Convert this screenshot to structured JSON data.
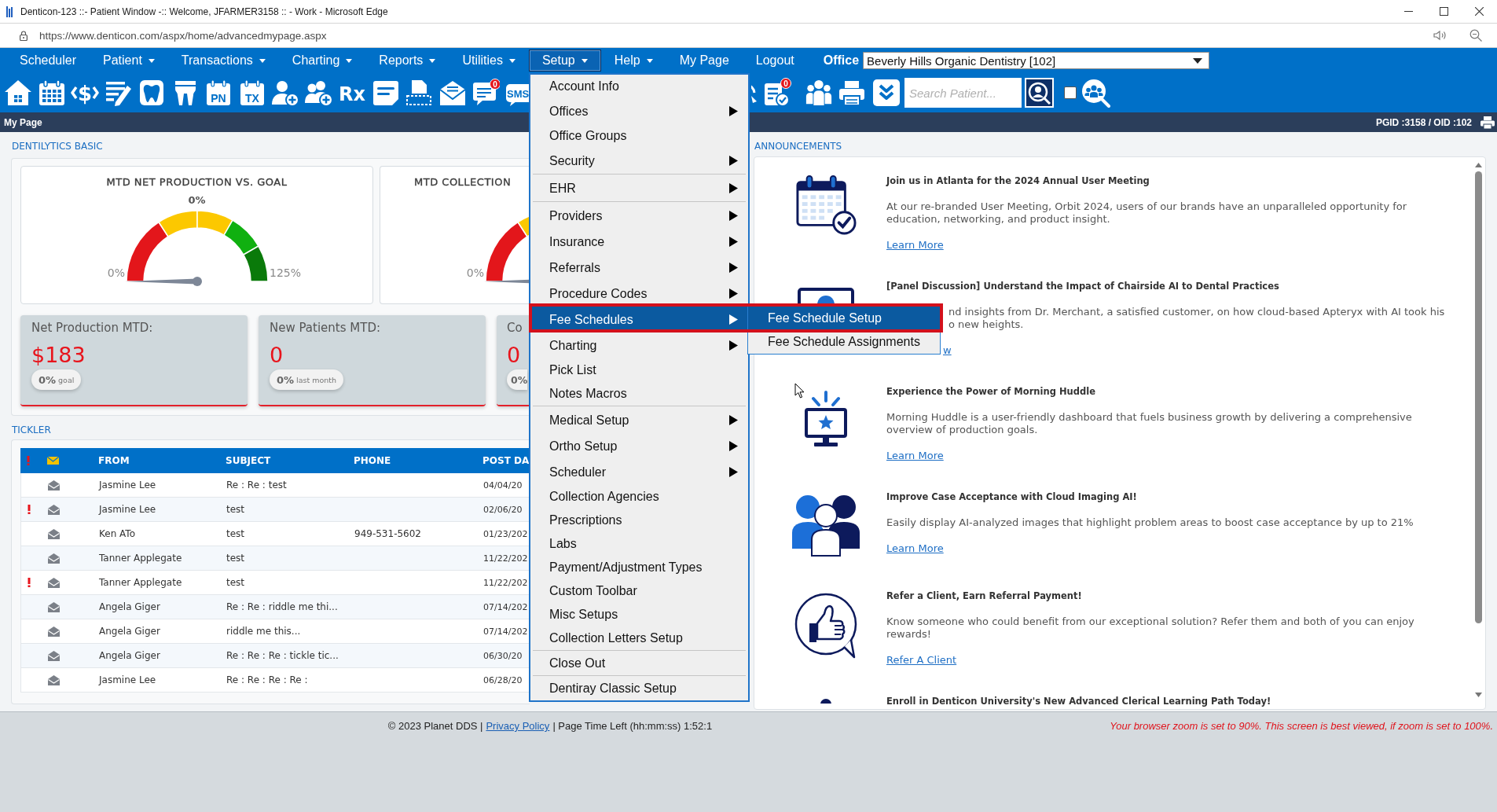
{
  "window": {
    "title": "Denticon-123 ::- Patient Window -:: Welcome, JFARMER3158 :: - Work - Microsoft Edge"
  },
  "address_bar": {
    "url": "https://www.denticon.com/aspx/home/advancedmypage.aspx"
  },
  "menubar": {
    "items": [
      {
        "label": "Scheduler",
        "has_dropdown": false,
        "selected": false
      },
      {
        "label": "Patient",
        "has_dropdown": true,
        "selected": false
      },
      {
        "label": "Transactions",
        "has_dropdown": true,
        "selected": false
      },
      {
        "label": "Charting",
        "has_dropdown": true,
        "selected": false
      },
      {
        "label": "Reports",
        "has_dropdown": true,
        "selected": false
      },
      {
        "label": "Utilities",
        "has_dropdown": true,
        "selected": false
      },
      {
        "label": "Setup",
        "has_dropdown": true,
        "selected": true
      },
      {
        "label": "Help",
        "has_dropdown": true,
        "selected": false
      },
      {
        "label": "My Page",
        "has_dropdown": false,
        "selected": false
      },
      {
        "label": "Logout",
        "has_dropdown": false,
        "selected": false
      }
    ],
    "office_label": "Office",
    "office_value": "Beverly Hills Organic Dentistry [102]"
  },
  "toolbar": {
    "left_tools": [
      {
        "kind": "home"
      },
      {
        "kind": "calendar"
      },
      {
        "kind": "dollar",
        "label": "$"
      },
      {
        "kind": "edit"
      },
      {
        "kind": "tooth"
      },
      {
        "kind": "teeth"
      },
      {
        "kind": "calendar_label",
        "label": "PN"
      },
      {
        "kind": "calendar_label",
        "label": "TX"
      },
      {
        "kind": "person_add"
      },
      {
        "kind": "people_add"
      },
      {
        "kind": "rx",
        "label": "Rx"
      },
      {
        "kind": "note"
      },
      {
        "kind": "scanner"
      },
      {
        "kind": "mail"
      },
      {
        "kind": "message",
        "badge": "0"
      },
      {
        "kind": "sms",
        "label": "SMS"
      }
    ],
    "right_tools": [
      {
        "kind": "arc"
      },
      {
        "kind": "checklist",
        "badge": "0"
      },
      {
        "kind": "people"
      },
      {
        "kind": "printer"
      },
      {
        "kind": "chevrons"
      }
    ],
    "search": {
      "placeholder": "Search Patient..."
    },
    "checkbox": {
      "checked": false
    }
  },
  "page_header": {
    "title": "My Page",
    "ids": "PGID :3158 / OID :102"
  },
  "dashboard": {
    "heading": "DENTILYTICS BASIC",
    "gauges": [
      {
        "title": "MTD NET PRODUCTION VS. GOAL",
        "reading": "0%",
        "min_label": "0%",
        "max_label": "125%",
        "level": 0,
        "cut_off": false
      },
      {
        "title": "MTD COLLECTION",
        "min_label": "0%",
        "level": 0,
        "cut_off": true
      }
    ],
    "kpis": [
      {
        "label": "Net Production MTD:",
        "value": "$183",
        "comparison": "**0%** goal",
        "cut_off": false
      },
      {
        "label": "New Patients MTD:",
        "value": "0",
        "comparison": "**0%** last month",
        "cut_off": false
      },
      {
        "label": "Co",
        "value": "0",
        "comparison": "**0%**",
        "cut_off": true
      }
    ]
  },
  "tickler": {
    "heading": "TICKLER",
    "columns": [
      "FROM",
      "SUBJECT",
      "PHONE",
      "POST DA"
    ],
    "rows": [
      {
        "flagged": false,
        "from": "Jasmine Lee",
        "subject": "Re : Re : test",
        "date": "04/04/20"
      },
      {
        "flagged": true,
        "from": "Jasmine Lee",
        "subject": "test",
        "date": "02/06/20"
      },
      {
        "flagged": false,
        "from": "Ken ATo",
        "subject": "test",
        "phone": "949-531-5602",
        "date": "01/23/202"
      },
      {
        "flagged": false,
        "from": "Tanner Applegate",
        "subject": "test",
        "date": "11/22/202"
      },
      {
        "flagged": true,
        "from": "Tanner Applegate",
        "subject": "test",
        "date": "11/22/202"
      },
      {
        "flagged": false,
        "from": "Angela Giger",
        "subject": "Re : Re : riddle me thi...",
        "date": "07/14/202"
      },
      {
        "flagged": false,
        "from": "Angela Giger",
        "subject": "riddle me this...",
        "date": "07/14/202"
      },
      {
        "flagged": false,
        "from": "Angela Giger",
        "subject": "Re : Re : Re : tickle tic...",
        "date": "06/30/20"
      },
      {
        "flagged": false,
        "from": "Jasmine Lee",
        "subject": "Re : Re : Re : Re :",
        "date": "06/28/20"
      }
    ]
  },
  "announcements": {
    "heading": "ANNOUNCEMENTS",
    "items": [
      {
        "kind": "calendar",
        "title": "Join us in Atlanta for the 2024 Annual User Meeting",
        "body": "At our re-branded User Meeting, Orbit 2024, users of our brands have an unparalleled opportunity for education, networking, and product insight.",
        "link": "Learn More"
      },
      {
        "kind": "monitor",
        "title": "[Panel Discussion] Understand the Impact of Chairside AI to Dental Practices",
        "visible_lines": [
          "nd insights from Dr. Merchant, a satisfied customer, on how cloud-based Apteryx with AI took his",
          "o new heights."
        ],
        "link": "w"
      },
      {
        "kind": "broadcast",
        "title": "Experience the Power of Morning Huddle",
        "body": "Morning Huddle is a user-friendly dashboard that fuels business growth by delivering a comprehensive overview of production goals.",
        "link": "Learn More"
      },
      {
        "kind": "people",
        "title": "Improve Case Acceptance with Cloud Imaging AI!",
        "body": "Easily display AI-analyzed images that highlight problem areas to boost case acceptance by up to 21%",
        "link": "Learn More"
      },
      {
        "kind": "thumbs",
        "title": "Refer a Client, Earn Referral Payment!",
        "body": "Know someone who could benefit from our exceptional solution? Refer them and both of you can enjoy rewards!",
        "link": "Refer A Client"
      },
      {
        "kind": "partial",
        "title": "Enroll in Denticon University's New Advanced Clerical Learning Path Today!"
      }
    ]
  },
  "setup_menu": {
    "groups": [
      {
        "items": [
          {
            "label": "Account Info",
            "has_submenu": false,
            "selected": false
          },
          {
            "label": "Offices",
            "has_submenu": true,
            "selected": false
          },
          {
            "label": "Office Groups",
            "has_submenu": false,
            "selected": false
          },
          {
            "label": "Security",
            "has_submenu": true,
            "selected": false
          }
        ]
      },
      {
        "items": [
          {
            "label": "EHR",
            "has_submenu": true,
            "selected": false
          }
        ]
      },
      {
        "items": [
          {
            "label": "Providers",
            "has_submenu": true,
            "selected": false
          },
          {
            "label": "Insurance",
            "has_submenu": true,
            "selected": false
          },
          {
            "label": "Referrals",
            "has_submenu": true,
            "selected": false
          },
          {
            "label": "Procedure Codes",
            "has_submenu": true,
            "selected": false
          },
          {
            "label": "Fee Schedules",
            "has_submenu": true,
            "selected": true
          },
          {
            "label": "Charting",
            "has_submenu": true,
            "selected": false
          },
          {
            "label": "Pick List",
            "has_submenu": false,
            "selected": false
          },
          {
            "label": "Notes Macros",
            "has_submenu": false,
            "selected": false
          }
        ]
      },
      {
        "items": [
          {
            "label": "Medical Setup",
            "has_submenu": true,
            "selected": false
          },
          {
            "label": "Ortho Setup",
            "has_submenu": true,
            "selected": false
          },
          {
            "label": "Scheduler",
            "has_submenu": true,
            "selected": false
          },
          {
            "label": "Collection Agencies",
            "has_submenu": false,
            "selected": false
          },
          {
            "label": "Prescriptions",
            "has_submenu": false,
            "selected": false
          },
          {
            "label": "Labs",
            "has_submenu": false,
            "selected": false
          },
          {
            "label": "Payment/Adjustment Types",
            "has_submenu": false,
            "selected": false
          },
          {
            "label": "Custom Toolbar",
            "has_submenu": false,
            "selected": false
          },
          {
            "label": "Misc Setups",
            "has_submenu": false,
            "selected": false
          },
          {
            "label": "Collection Letters Setup",
            "has_submenu": false,
            "selected": false
          }
        ]
      },
      {
        "items": [
          {
            "label": "Close Out",
            "has_submenu": false,
            "selected": false
          }
        ]
      },
      {
        "items": [
          {
            "label": "Dentiray Classic Setup",
            "has_submenu": false,
            "selected": false
          }
        ]
      }
    ],
    "submenu": {
      "items": [
        {
          "label": "Fee Schedule Setup",
          "selected": true
        },
        {
          "label": "Fee Schedule Assignments",
          "selected": false
        }
      ]
    }
  },
  "footer": {
    "copyright": "© 2023 Planet DDS |",
    "privacy_link": "Privacy Policy",
    "time_left": "| Page Time Left (hh:mm:ss) 1:52:1",
    "zoom_warning": "Your browser zoom is set to 90%. This screen is best viewed, if zoom is set to 100%."
  }
}
